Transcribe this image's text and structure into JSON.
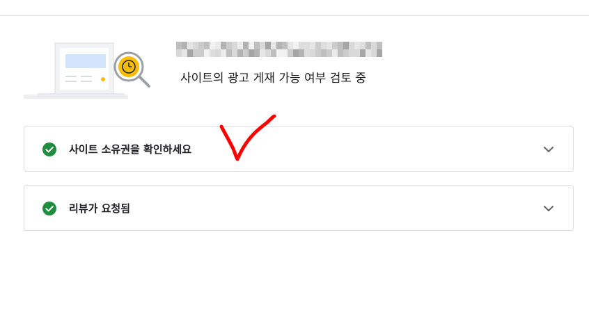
{
  "header": {
    "site_name": "",
    "review_status": "사이트의 광고 게재 가능 여부 검토 중"
  },
  "illustration": {
    "name": "site-review-illustration",
    "accent_color": "#fbbc04",
    "panel_color": "#d2e3fc"
  },
  "steps": [
    {
      "label": "사이트 소유권을 확인하세요",
      "status": "complete",
      "icon": "check-circle-icon",
      "expand_icon": "chevron-down-icon"
    },
    {
      "label": "리뷰가 요청됨",
      "status": "complete",
      "icon": "check-circle-icon",
      "expand_icon": "chevron-down-icon"
    }
  ],
  "colors": {
    "success": "#1e8e3e",
    "border": "#dadce0",
    "annotation": "#ff0000"
  },
  "annotation": {
    "type": "hand-drawn-checkmark"
  }
}
